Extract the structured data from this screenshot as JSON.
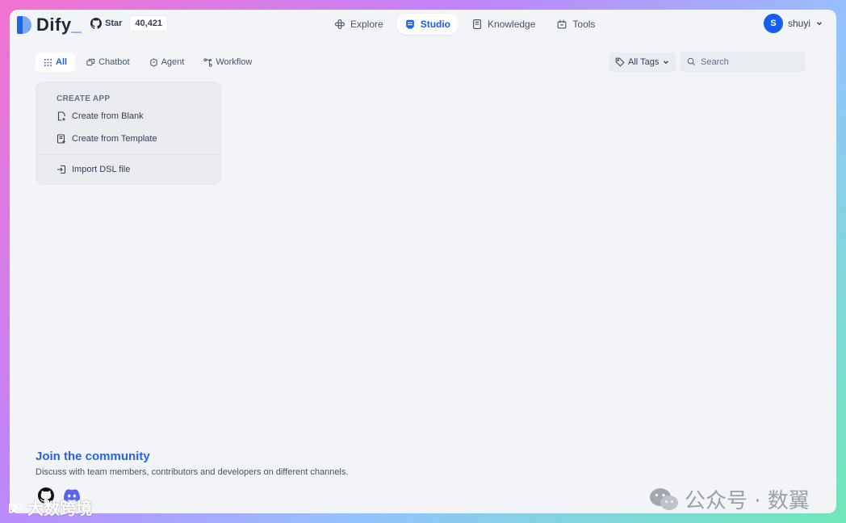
{
  "brand": {
    "name": "Dify",
    "suffix": "_"
  },
  "github": {
    "label": "Star",
    "count": "40,421"
  },
  "nav": [
    {
      "label": "Explore",
      "icon": "explore-icon"
    },
    {
      "label": "Studio",
      "icon": "studio-icon",
      "active": true
    },
    {
      "label": "Knowledge",
      "icon": "knowledge-icon"
    },
    {
      "label": "Tools",
      "icon": "tools-icon"
    }
  ],
  "user": {
    "initial": "S",
    "name": "shuyi"
  },
  "filters": [
    {
      "label": "All",
      "active": true
    },
    {
      "label": "Chatbot"
    },
    {
      "label": "Agent"
    },
    {
      "label": "Workflow"
    }
  ],
  "tags": {
    "label": "All Tags"
  },
  "search": {
    "placeholder": "Search",
    "value": ""
  },
  "create_app": {
    "title": "CREATE APP",
    "blank": "Create from Blank",
    "template": "Create from Template",
    "import": "Import DSL file"
  },
  "community": {
    "title": "Join the community",
    "description": "Discuss with team members, contributors and developers on different channels."
  },
  "watermarks": {
    "right": "公众号 · 数翼",
    "left": "大数跨境"
  },
  "colors": {
    "accent": "#155eef",
    "community_title": "#2563eb",
    "background": "#f2f4f7"
  }
}
